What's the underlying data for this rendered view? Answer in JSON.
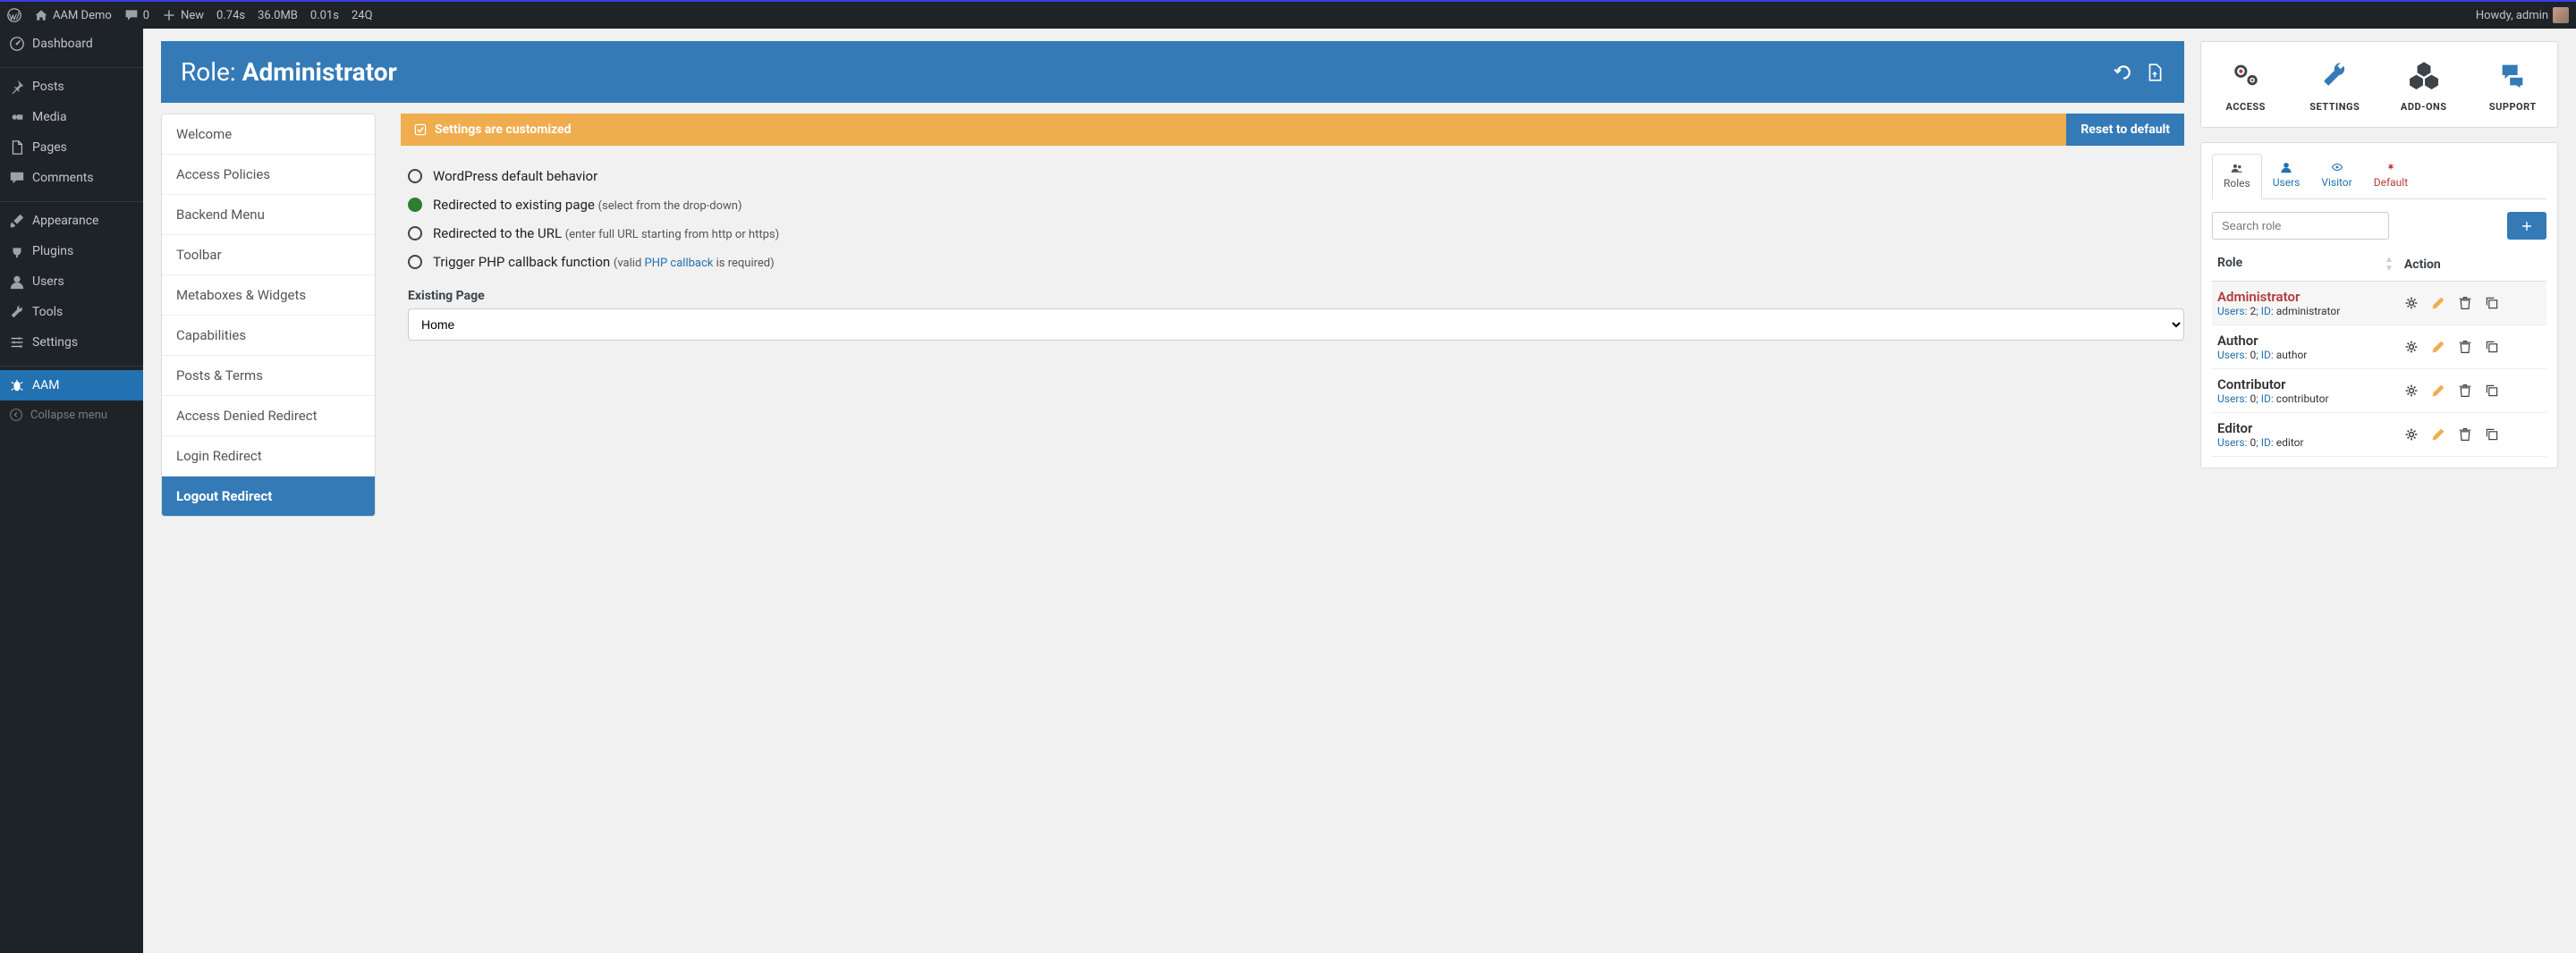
{
  "adminbar": {
    "site": "AAM Demo",
    "comments": "0",
    "new": "New",
    "stats": [
      "0.74s",
      "36.0MB",
      "0.01s",
      "24Q"
    ],
    "howdy": "Howdy, admin"
  },
  "sidebar": {
    "items": [
      {
        "label": "Dashboard"
      },
      {
        "label": "Posts"
      },
      {
        "label": "Media"
      },
      {
        "label": "Pages"
      },
      {
        "label": "Comments"
      },
      {
        "label": "Appearance"
      },
      {
        "label": "Plugins"
      },
      {
        "label": "Users"
      },
      {
        "label": "Tools"
      },
      {
        "label": "Settings"
      },
      {
        "label": "AAM"
      }
    ],
    "collapse": "Collapse menu"
  },
  "role_header": {
    "prefix": "Role:",
    "name": "Administrator"
  },
  "features": [
    "Welcome",
    "Access Policies",
    "Backend Menu",
    "Toolbar",
    "Metaboxes & Widgets",
    "Capabilities",
    "Posts & Terms",
    "Access Denied Redirect",
    "Login Redirect",
    "Logout Redirect"
  ],
  "banner": {
    "msg": "Settings are customized",
    "reset": "Reset to default"
  },
  "radios": {
    "opt0": "WordPress default behavior",
    "opt1": "Redirected to existing page",
    "opt1_hint": "(select from the drop-down)",
    "opt2": "Redirected to the URL",
    "opt2_hint": "(enter full URL starting from http or https)",
    "opt3": "Trigger PHP callback function",
    "opt3_hint_pre": "(valid ",
    "opt3_link": "PHP callback",
    "opt3_hint_post": " is required)"
  },
  "existing_page": {
    "label": "Existing Page",
    "value": "Home"
  },
  "navcards": [
    "ACCESS",
    "SETTINGS",
    "ADD-ONS",
    "SUPPORT"
  ],
  "subject_tabs": [
    "Roles",
    "Users",
    "Visitor",
    "Default"
  ],
  "search_placeholder": "Search role",
  "table": {
    "col_role": "Role",
    "col_action": "Action",
    "rows": [
      {
        "name": "Administrator",
        "users": "2",
        "id": "administrator"
      },
      {
        "name": "Author",
        "users": "0",
        "id": "author"
      },
      {
        "name": "Contributor",
        "users": "0",
        "id": "contributor"
      },
      {
        "name": "Editor",
        "users": "0",
        "id": "editor"
      }
    ]
  },
  "meta_labels": {
    "users": "Users:",
    "id": "ID:"
  }
}
